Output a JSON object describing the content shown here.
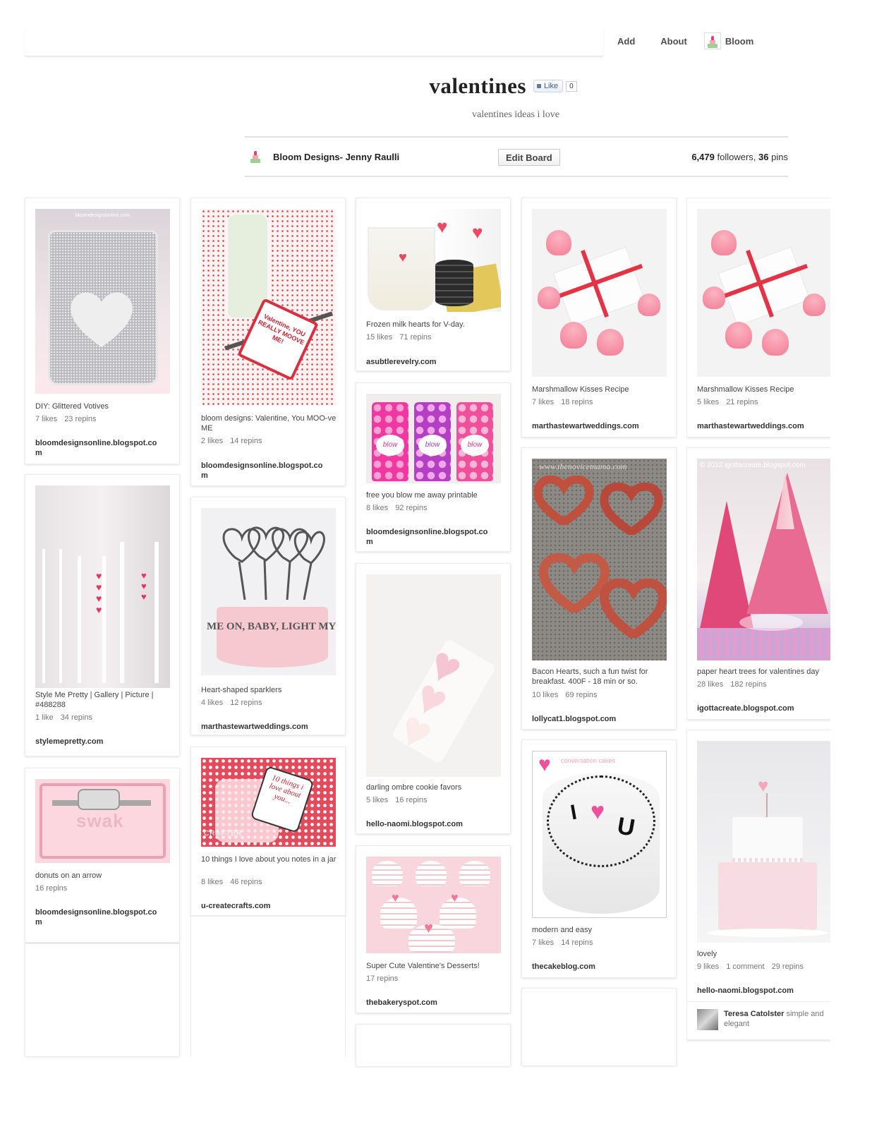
{
  "header": {
    "nav": {
      "add": "Add",
      "about": "About",
      "user_name": "Bloom"
    }
  },
  "board": {
    "title": "valentines",
    "like_label": "Like",
    "like_count": "0",
    "description": "valentines ideas i love",
    "owner_name": "Bloom Designs- Jenny Raulli",
    "edit_label": "Edit Board",
    "followers_count": "6,479",
    "followers_label": "followers,",
    "pins_count": "36",
    "pins_label": "pins"
  },
  "pins": {
    "c1p1": {
      "desc": "DIY: Glittered Votives",
      "likes": "7 likes",
      "repins": "23 repins",
      "source": "bloomdesignsonline.blogspot.com",
      "watermark": "bloomdesignsonline.com"
    },
    "c1p2": {
      "desc": "Style Me Pretty | Gallery | Picture | #488288",
      "likes": "1 like",
      "repins": "34 repins",
      "source": "stylemepretty.com"
    },
    "c1p3": {
      "desc": "donuts on an arrow",
      "repins": "16 repins",
      "source": "bloomdesignsonline.blogspot.com",
      "image_text": "swak"
    },
    "c2p1": {
      "desc": "bloom designs: Valentine, You MOO-ve ME",
      "likes": "2 likes",
      "repins": "14 repins",
      "source": "bloomdesignsonline.blogspot.com",
      "tag_text": "Valentine, YOU REALLY MOOVE ME!"
    },
    "c2p2": {
      "desc": "Heart-shaped sparklers",
      "likes": "4 likes",
      "repins": "12 repins",
      "source": "marthastewartweddings.com",
      "image_text": "ME ON, BABY, LIGHT MY FI"
    },
    "c2p3": {
      "desc": "10 things I love about you notes in a jar",
      "likes": "8 likes",
      "repins": "46 repins",
      "source": "u-createcrafts.com",
      "tag_text": "10 things i love about you...",
      "watermark": "CRAFTER"
    },
    "c3p1": {
      "desc": "Frozen milk hearts for V-day.",
      "likes": "15 likes",
      "repins": "71 repins",
      "source": "asubtlerevelry.com"
    },
    "c3p2": {
      "desc": "free you blow me away printable",
      "likes": "8 likes",
      "repins": "92 repins",
      "source": "bloomdesignsonline.blogspot.com",
      "bottle_text": "blow"
    },
    "c3p3": {
      "desc": "darling ombre cookie favors",
      "likes": "5 likes",
      "repins": "16 repins",
      "source": "hello-naomi.blogspot.com"
    },
    "c3p4": {
      "desc": "Super Cute Valentine's Desserts!",
      "repins": "17 repins",
      "source": "thebakeryspot.com"
    },
    "c4p1": {
      "desc": "Marshmallow Kisses Recipe",
      "likes": "7 likes",
      "repins": "18 repins",
      "source": "marthastewartweddings.com"
    },
    "c4p2": {
      "desc": "Bacon Hearts, such a fun twist for breakfast. 400F - 18 min or so.",
      "likes": "10 likes",
      "repins": "69 repins",
      "source": "lollycat1.blogspot.com",
      "watermark": "www.thenovicemama.com"
    },
    "c4p3": {
      "desc": "modern and easy",
      "likes": "7 likes",
      "repins": "14 repins",
      "source": "thecakeblog.com",
      "cake_text_1": "I",
      "cake_text_2": "U",
      "watermark": "conversation cakes"
    },
    "c5p1": {
      "desc": "Marshmallow Kisses Recipe",
      "likes": "5 likes",
      "repins": "21 repins",
      "source": "marthastewartweddings.com"
    },
    "c5p2": {
      "desc": "paper heart trees for valentines day",
      "likes": "28 likes",
      "repins": "182 repins",
      "source": "igottacreate.blogspot.com",
      "watermark": "© 2012 igottacreate.blogspot.com"
    },
    "c5p3": {
      "desc": "lovely",
      "likes": "9 likes",
      "comments": "1 comment",
      "repins": "29 repins",
      "source": "hello-naomi.blogspot.com",
      "comment": {
        "author": "Teresa Catolster",
        "text": "simple and elegant"
      }
    }
  },
  "colors": {
    "accent_pink": "#e34b5c",
    "text_dark": "#222222",
    "link_blue": "#3b5998"
  }
}
